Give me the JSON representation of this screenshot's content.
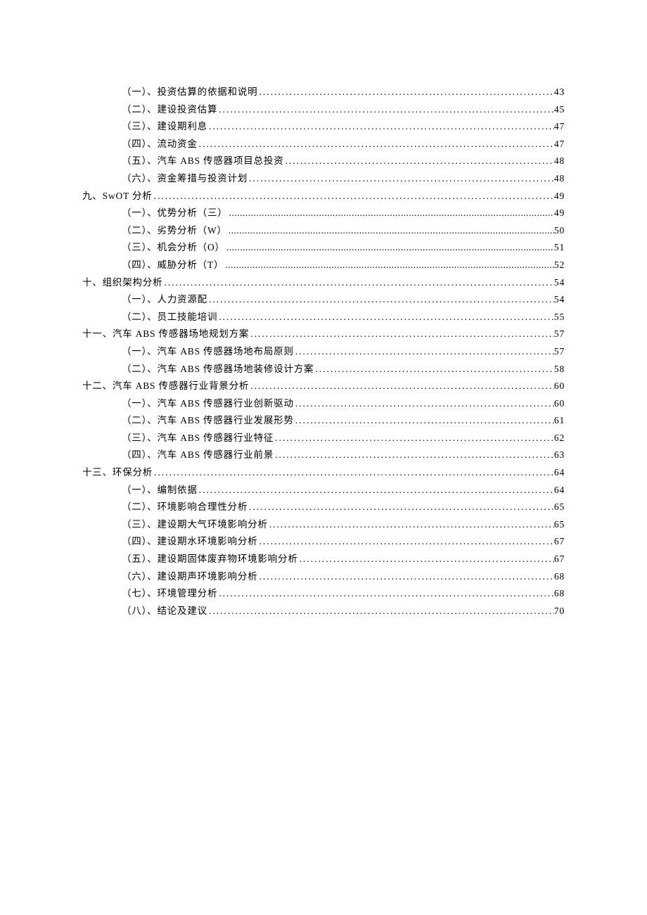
{
  "toc": [
    {
      "level": 2,
      "text": "（一）、投资估算的依据和说明",
      "page": "43",
      "leader": "wide"
    },
    {
      "level": 2,
      "text": "（二）、建设投资估算",
      "page": "45",
      "leader": "wide"
    },
    {
      "level": 2,
      "text": "（三）、建设期利息",
      "page": "47",
      "leader": "wide"
    },
    {
      "level": 2,
      "text": "（四）、流动资金",
      "page": "47",
      "leader": "wide"
    },
    {
      "level": 2,
      "text": "（五）、汽车 ABS 传感器项目总投资",
      "page": "48",
      "leader": "wide"
    },
    {
      "level": 2,
      "text": "（六）、资金筹措与投资计划",
      "page": "48",
      "leader": "wide"
    },
    {
      "level": 1,
      "text": "九、SwOT 分析",
      "page": "49",
      "leader": "wide"
    },
    {
      "level": 2,
      "text": "（一）、优势分析（三）",
      "page": "49",
      "leader": "tight"
    },
    {
      "level": 2,
      "text": "（二）、劣势分析（W）",
      "page": "50",
      "leader": "tight"
    },
    {
      "level": 2,
      "text": "（三）、机会分析（O）",
      "page": "51",
      "leader": "tight"
    },
    {
      "level": 2,
      "text": "（四）、威胁分析（T）",
      "page": "52",
      "leader": "tight"
    },
    {
      "level": 1,
      "text": "十、组织架构分析",
      "page": "54",
      "leader": "wide"
    },
    {
      "level": 2,
      "text": "（一）、人力资源配",
      "page": "54",
      "leader": "wide"
    },
    {
      "level": 2,
      "text": "（二）、员工技能培训",
      "page": "55",
      "leader": "wide"
    },
    {
      "level": 1,
      "text": "十一、汽车 ABS 传感器场地规划方案",
      "page": "57",
      "leader": "wide"
    },
    {
      "level": 2,
      "text": "（一）、汽车 ABS 传感器场地布局原则",
      "page": "57",
      "leader": "wide"
    },
    {
      "level": 2,
      "text": "（二）、汽车 ABS 传感器场地装修设计方案",
      "page": "58",
      "leader": "wide"
    },
    {
      "level": 1,
      "text": "十二、汽车 ABS 传感器行业背景分析",
      "page": "60",
      "leader": "wide"
    },
    {
      "level": 2,
      "text": "（一）、汽车 ABS 传感器行业创新驱动",
      "page": "60",
      "leader": "wide"
    },
    {
      "level": 2,
      "text": "（二）、汽车 ABS 传感器行业发展形势",
      "page": "61",
      "leader": "wide"
    },
    {
      "level": 2,
      "text": "（三）、汽车 ABS 传感器行业特征",
      "page": "62",
      "leader": "wide"
    },
    {
      "level": 2,
      "text": "（四）、汽车 ABS 传感器行业前景",
      "page": "63",
      "leader": "wide"
    },
    {
      "level": 1,
      "text": "十三、环保分析",
      "page": "64",
      "leader": "wide"
    },
    {
      "level": 2,
      "text": "（一）、编制依据",
      "page": "64",
      "leader": "wide"
    },
    {
      "level": 2,
      "text": "（二）、环境影响合理性分析",
      "page": "65",
      "leader": "wide"
    },
    {
      "level": 2,
      "text": "（三）、建设期大气环境影响分析",
      "page": "65",
      "leader": "wide"
    },
    {
      "level": 2,
      "text": "（四）、建设期水环境影响分析",
      "page": "67",
      "leader": "wide"
    },
    {
      "level": 2,
      "text": "（五）、建设期固体废弃物环境影响分析",
      "page": "67",
      "leader": "wide"
    },
    {
      "level": 2,
      "text": "（六）、建设期声环境影响分析",
      "page": "68",
      "leader": "wide"
    },
    {
      "level": 2,
      "text": "（七）、环境管理分析",
      "page": "68",
      "leader": "wide"
    },
    {
      "level": 2,
      "text": "（八）、结论及建议",
      "page": "70",
      "leader": "wide"
    }
  ]
}
